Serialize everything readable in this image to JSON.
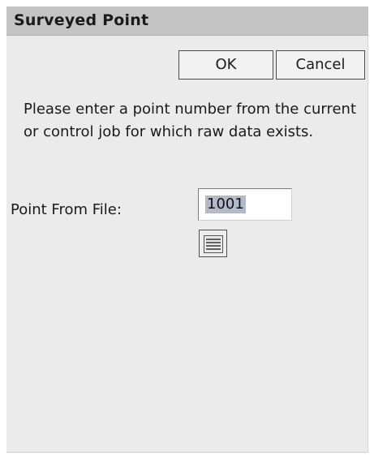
{
  "dialog": {
    "title": "Surveyed Point",
    "ok_label": "OK",
    "cancel_label": "Cancel",
    "message": "Please enter a point number from the current or control job for which raw data exists.",
    "field_label": "Point From File:",
    "field_value": "1001",
    "list_button_icon": "list-icon"
  },
  "colors": {
    "titlebar": "#c4c4c4",
    "dialog_bg": "#ebebeb",
    "selection": "#b3b9c9"
  }
}
